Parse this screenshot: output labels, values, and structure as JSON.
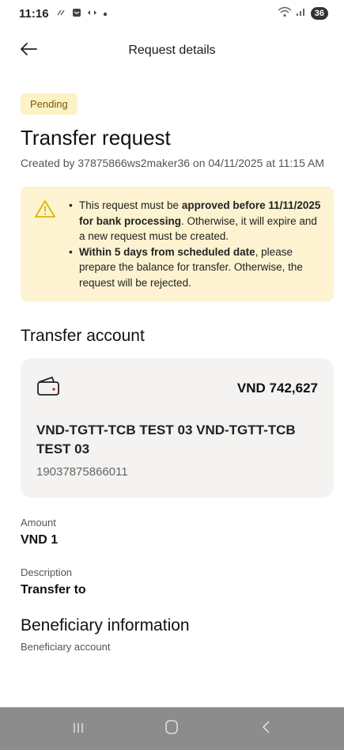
{
  "status_bar": {
    "time": "11:16",
    "left_icons": [
      "sync-icon",
      "message-icon",
      "data-icon",
      "dot-icon"
    ],
    "battery": "36"
  },
  "header": {
    "back_icon": "arrow-left-icon",
    "title": "Request details"
  },
  "request": {
    "status_badge": "Pending",
    "title": "Transfer request",
    "created_text": "Created by 37875866ws2maker36 on 04/11/2025 at 11:15 AM"
  },
  "alert": {
    "icon": "warning-icon",
    "item1_part1": "This request must be ",
    "item1_bold": "approved before 11/11/2025 for bank processing",
    "item1_part2": ". Otherwise, it will expire and a new request must be created.",
    "item2_bold": "Within 5 days from scheduled date",
    "item2_part2": ", please prepare the balance for transfer. Otherwise, the request will be rejected.",
    "colors": {
      "background": "#fdf3d0",
      "icon": "#e0b400"
    }
  },
  "transfer_account": {
    "section_title": "Transfer account",
    "icon": "wallet-icon",
    "balance": "VND 742,627",
    "account_name": "VND-TGTT-TCB TEST 03 VND-TGTT-TCB TEST 03",
    "account_number": "19037875866011"
  },
  "amount": {
    "label": "Amount",
    "value": "VND 1"
  },
  "description": {
    "label": "Description",
    "value": "Transfer to"
  },
  "beneficiary": {
    "section_title": "Beneficiary information",
    "partial_label": "Beneficiary account"
  },
  "nav_bar": {
    "recents_icon": "recents-icon",
    "home_icon": "home-icon",
    "back_icon": "back-icon"
  }
}
